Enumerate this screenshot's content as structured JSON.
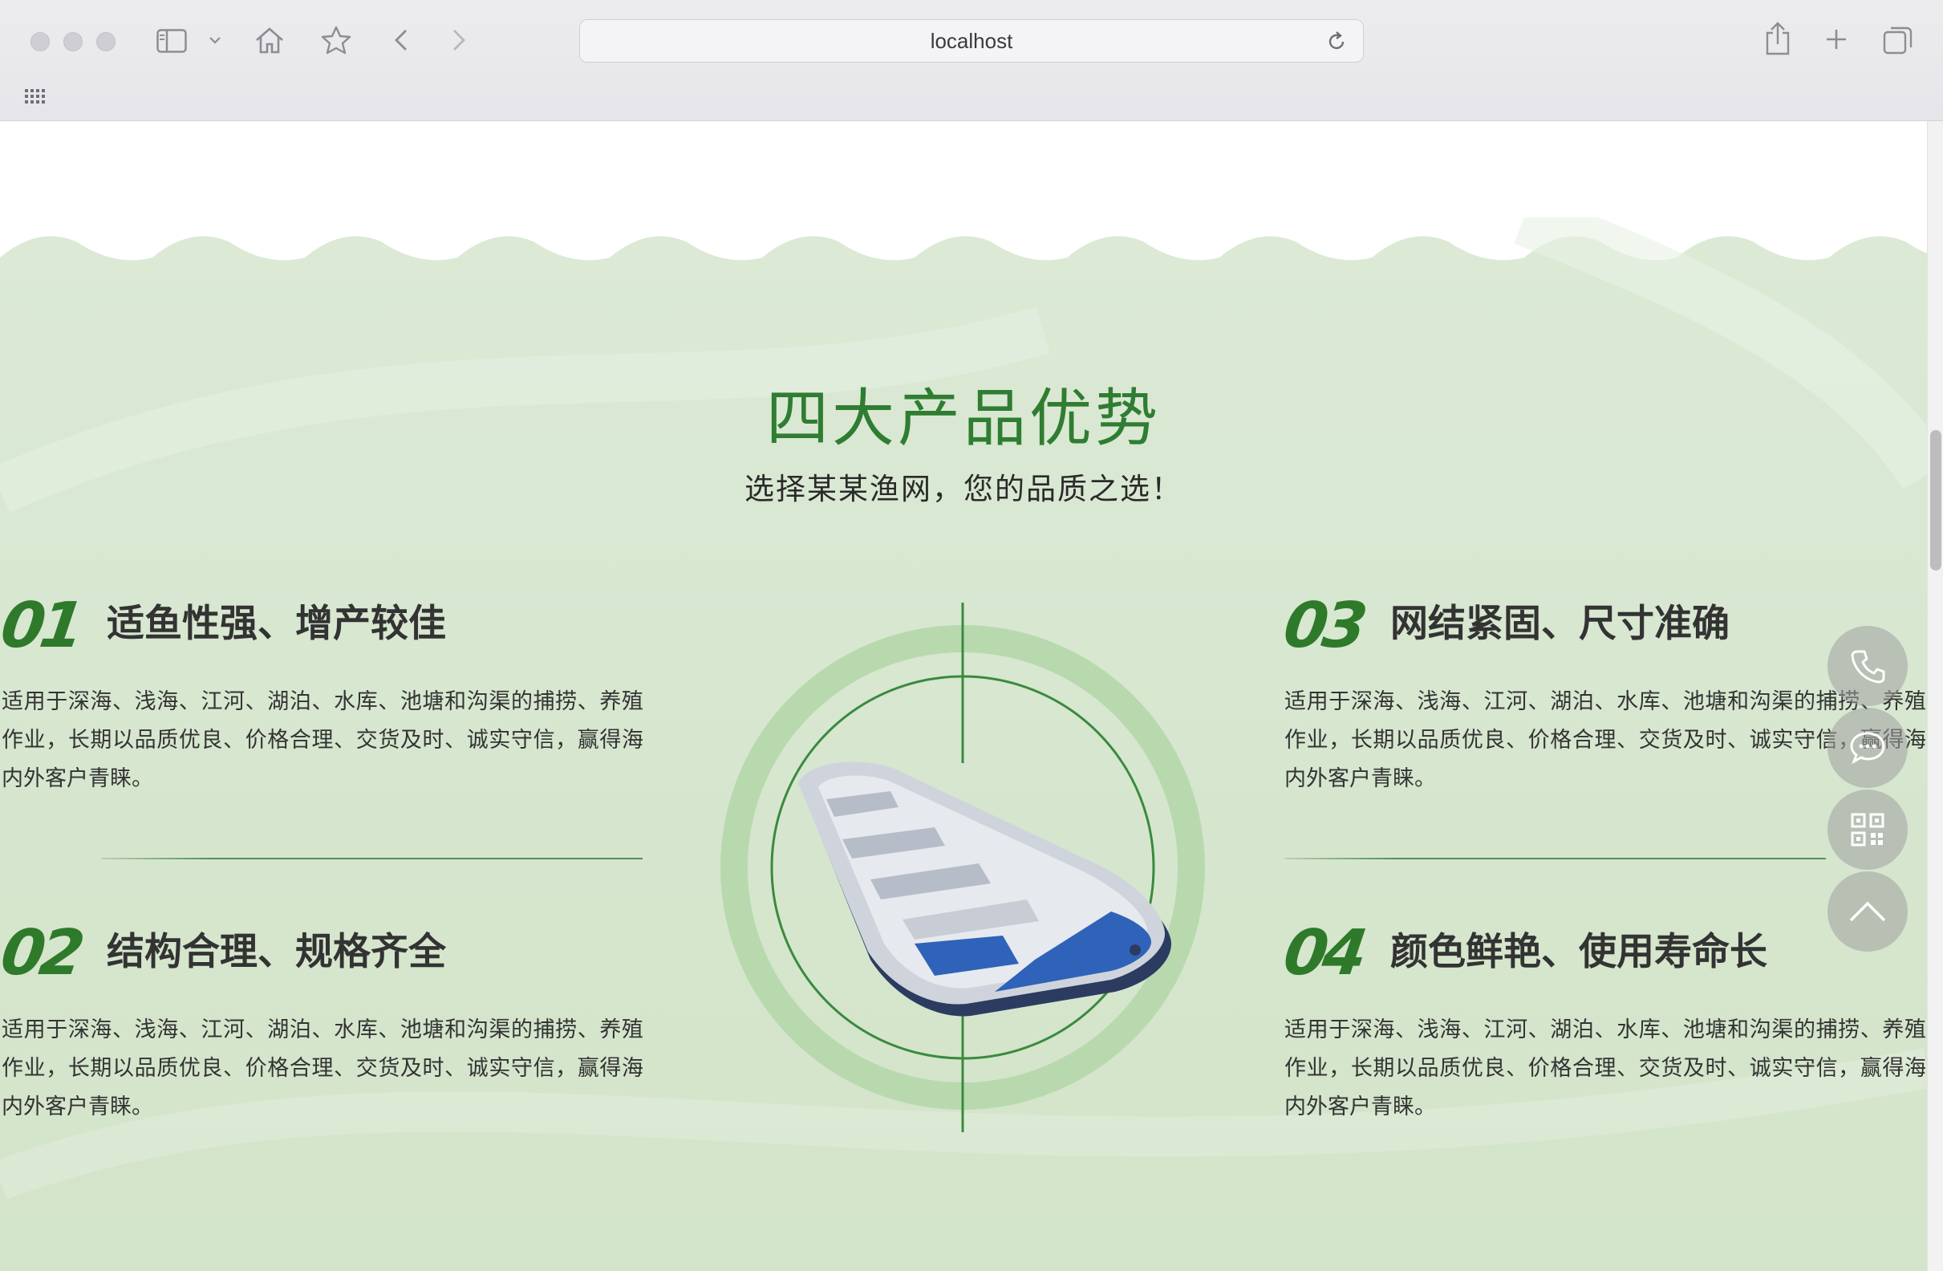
{
  "browser": {
    "url": "localhost",
    "icons": [
      "sidebar-icon",
      "home-icon",
      "bookmark-star-icon",
      "back-icon",
      "forward-icon",
      "reload-icon",
      "share-icon",
      "new-tab-icon",
      "tab-overview-icon",
      "apps-grid-icon"
    ]
  },
  "section": {
    "title": "四大产品优势",
    "subtitle": "选择某某渔网，您的品质之选！"
  },
  "features": [
    {
      "number": "01",
      "title": "适鱼性强、增产较佳",
      "description": "适用于深海、浅海、江河、湖泊、水库、池塘和沟渠的捕捞、养殖作业，长期以品质优良、价格合理、交货及时、诚实守信，赢得海内外客户青睐。"
    },
    {
      "number": "02",
      "title": "结构合理、规格齐全",
      "description": "适用于深海、浅海、江河、湖泊、水库、池塘和沟渠的捕捞、养殖作业，长期以品质优良、价格合理、交货及时、诚实守信，赢得海内外客户青睐。"
    },
    {
      "number": "03",
      "title": "网结紧固、尺寸准确",
      "description": "适用于深海、浅海、江河、湖泊、水库、池塘和沟渠的捕捞、养殖作业，长期以品质优良、价格合理、交货及时、诚实守信，赢得海内外客户青睐。"
    },
    {
      "number": "04",
      "title": "颜色鲜艳、使用寿命长",
      "description": "适用于深海、浅海、江河、湖泊、水库、池塘和沟渠的捕捞、养殖作业，长期以品质优良、价格合理、交货及时、诚实守信，赢得海内外客户青睐。"
    }
  ],
  "floating_buttons": [
    "phone-icon",
    "chat-icon",
    "qr-code-icon",
    "back-to-top-icon"
  ],
  "colors": {
    "accent": "#2f7d32",
    "background": "#d7e8d0"
  }
}
